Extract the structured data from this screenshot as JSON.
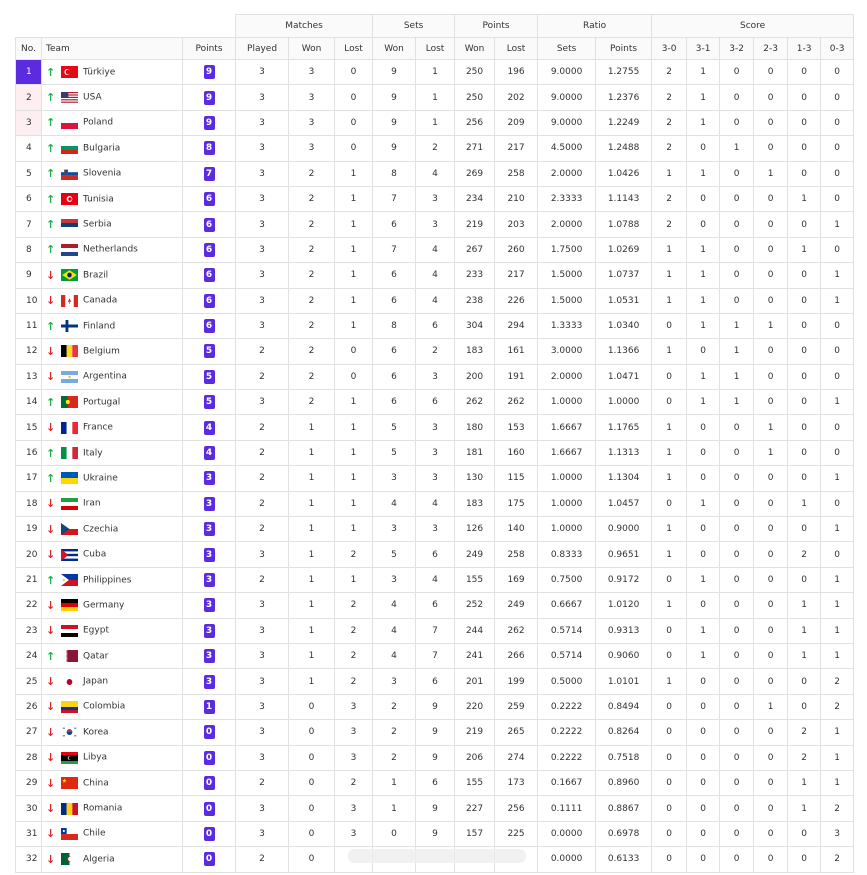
{
  "header": {
    "groups": {
      "matches": "Matches",
      "sets": "Sets",
      "points": "Points",
      "ratio": "Ratio",
      "score": "Score"
    },
    "cols": {
      "no": "No.",
      "team": "Team",
      "points": "Points",
      "played": "Played",
      "m_won": "Won",
      "m_lost": "Lost",
      "s_won": "Won",
      "s_lost": "Lost",
      "p_won": "Won",
      "p_lost": "Lost",
      "r_sets": "Sets",
      "r_points": "Points",
      "s30": "3-0",
      "s31": "3-1",
      "s32": "3-2",
      "s23": "2-3",
      "s13": "1-3",
      "s03": "0-3"
    }
  },
  "colors": {
    "accent": "#5b2be0",
    "up": "#1fae4b",
    "down": "#e0262b",
    "highlight": "#fdeff1"
  },
  "rows": [
    {
      "no": "1",
      "trend": "up",
      "team": "Türkiye",
      "flag": "tr",
      "pts": "9",
      "played": "3",
      "mw": "3",
      "ml": "0",
      "sw": "9",
      "sl": "1",
      "pw": "250",
      "pl": "196",
      "rs": "9.0000",
      "rp": "1.2755",
      "s30": "2",
      "s31": "1",
      "s32": "0",
      "s23": "0",
      "s13": "0",
      "s03": "0"
    },
    {
      "no": "2",
      "trend": "up",
      "team": "USA",
      "flag": "us",
      "pts": "9",
      "played": "3",
      "mw": "3",
      "ml": "0",
      "sw": "9",
      "sl": "1",
      "pw": "250",
      "pl": "202",
      "rs": "9.0000",
      "rp": "1.2376",
      "s30": "2",
      "s31": "1",
      "s32": "0",
      "s23": "0",
      "s13": "0",
      "s03": "0"
    },
    {
      "no": "3",
      "trend": "up",
      "team": "Poland",
      "flag": "pl",
      "pts": "9",
      "played": "3",
      "mw": "3",
      "ml": "0",
      "sw": "9",
      "sl": "1",
      "pw": "256",
      "pl": "209",
      "rs": "9.0000",
      "rp": "1.2249",
      "s30": "2",
      "s31": "1",
      "s32": "0",
      "s23": "0",
      "s13": "0",
      "s03": "0"
    },
    {
      "no": "4",
      "trend": "up",
      "team": "Bulgaria",
      "flag": "bg",
      "pts": "8",
      "played": "3",
      "mw": "3",
      "ml": "0",
      "sw": "9",
      "sl": "2",
      "pw": "271",
      "pl": "217",
      "rs": "4.5000",
      "rp": "1.2488",
      "s30": "2",
      "s31": "0",
      "s32": "1",
      "s23": "0",
      "s13": "0",
      "s03": "0"
    },
    {
      "no": "5",
      "trend": "up",
      "team": "Slovenia",
      "flag": "si",
      "pts": "7",
      "played": "3",
      "mw": "2",
      "ml": "1",
      "sw": "8",
      "sl": "4",
      "pw": "269",
      "pl": "258",
      "rs": "2.0000",
      "rp": "1.0426",
      "s30": "1",
      "s31": "1",
      "s32": "0",
      "s23": "1",
      "s13": "0",
      "s03": "0"
    },
    {
      "no": "6",
      "trend": "up",
      "team": "Tunisia",
      "flag": "tn",
      "pts": "6",
      "played": "3",
      "mw": "2",
      "ml": "1",
      "sw": "7",
      "sl": "3",
      "pw": "234",
      "pl": "210",
      "rs": "2.3333",
      "rp": "1.1143",
      "s30": "2",
      "s31": "0",
      "s32": "0",
      "s23": "0",
      "s13": "1",
      "s03": "0"
    },
    {
      "no": "7",
      "trend": "up",
      "team": "Serbia",
      "flag": "rs",
      "pts": "6",
      "played": "3",
      "mw": "2",
      "ml": "1",
      "sw": "6",
      "sl": "3",
      "pw": "219",
      "pl": "203",
      "rs": "2.0000",
      "rp": "1.0788",
      "s30": "2",
      "s31": "0",
      "s32": "0",
      "s23": "0",
      "s13": "0",
      "s03": "1"
    },
    {
      "no": "8",
      "trend": "up",
      "team": "Netherlands",
      "flag": "nl",
      "pts": "6",
      "played": "3",
      "mw": "2",
      "ml": "1",
      "sw": "7",
      "sl": "4",
      "pw": "267",
      "pl": "260",
      "rs": "1.7500",
      "rp": "1.0269",
      "s30": "1",
      "s31": "1",
      "s32": "0",
      "s23": "0",
      "s13": "1",
      "s03": "0"
    },
    {
      "no": "9",
      "trend": "down",
      "team": "Brazil",
      "flag": "br",
      "pts": "6",
      "played": "3",
      "mw": "2",
      "ml": "1",
      "sw": "6",
      "sl": "4",
      "pw": "233",
      "pl": "217",
      "rs": "1.5000",
      "rp": "1.0737",
      "s30": "1",
      "s31": "1",
      "s32": "0",
      "s23": "0",
      "s13": "0",
      "s03": "1"
    },
    {
      "no": "10",
      "trend": "down",
      "team": "Canada",
      "flag": "ca",
      "pts": "6",
      "played": "3",
      "mw": "2",
      "ml": "1",
      "sw": "6",
      "sl": "4",
      "pw": "238",
      "pl": "226",
      "rs": "1.5000",
      "rp": "1.0531",
      "s30": "1",
      "s31": "1",
      "s32": "0",
      "s23": "0",
      "s13": "0",
      "s03": "1"
    },
    {
      "no": "11",
      "trend": "up",
      "team": "Finland",
      "flag": "fi",
      "pts": "6",
      "played": "3",
      "mw": "2",
      "ml": "1",
      "sw": "8",
      "sl": "6",
      "pw": "304",
      "pl": "294",
      "rs": "1.3333",
      "rp": "1.0340",
      "s30": "0",
      "s31": "1",
      "s32": "1",
      "s23": "1",
      "s13": "0",
      "s03": "0"
    },
    {
      "no": "12",
      "trend": "down",
      "team": "Belgium",
      "flag": "be",
      "pts": "5",
      "played": "2",
      "mw": "2",
      "ml": "0",
      "sw": "6",
      "sl": "2",
      "pw": "183",
      "pl": "161",
      "rs": "3.0000",
      "rp": "1.1366",
      "s30": "1",
      "s31": "0",
      "s32": "1",
      "s23": "0",
      "s13": "0",
      "s03": "0"
    },
    {
      "no": "13",
      "trend": "down",
      "team": "Argentina",
      "flag": "ar",
      "pts": "5",
      "played": "2",
      "mw": "2",
      "ml": "0",
      "sw": "6",
      "sl": "3",
      "pw": "200",
      "pl": "191",
      "rs": "2.0000",
      "rp": "1.0471",
      "s30": "0",
      "s31": "1",
      "s32": "1",
      "s23": "0",
      "s13": "0",
      "s03": "0"
    },
    {
      "no": "14",
      "trend": "up",
      "team": "Portugal",
      "flag": "pt",
      "pts": "5",
      "played": "3",
      "mw": "2",
      "ml": "1",
      "sw": "6",
      "sl": "6",
      "pw": "262",
      "pl": "262",
      "rs": "1.0000",
      "rp": "1.0000",
      "s30": "0",
      "s31": "1",
      "s32": "1",
      "s23": "0",
      "s13": "0",
      "s03": "1"
    },
    {
      "no": "15",
      "trend": "down",
      "team": "France",
      "flag": "fr",
      "pts": "4",
      "played": "2",
      "mw": "1",
      "ml": "1",
      "sw": "5",
      "sl": "3",
      "pw": "180",
      "pl": "153",
      "rs": "1.6667",
      "rp": "1.1765",
      "s30": "1",
      "s31": "0",
      "s32": "0",
      "s23": "1",
      "s13": "0",
      "s03": "0"
    },
    {
      "no": "16",
      "trend": "up",
      "team": "Italy",
      "flag": "it",
      "pts": "4",
      "played": "2",
      "mw": "1",
      "ml": "1",
      "sw": "5",
      "sl": "3",
      "pw": "181",
      "pl": "160",
      "rs": "1.6667",
      "rp": "1.1313",
      "s30": "1",
      "s31": "0",
      "s32": "0",
      "s23": "1",
      "s13": "0",
      "s03": "0"
    },
    {
      "no": "17",
      "trend": "up",
      "team": "Ukraine",
      "flag": "ua",
      "pts": "3",
      "played": "2",
      "mw": "1",
      "ml": "1",
      "sw": "3",
      "sl": "3",
      "pw": "130",
      "pl": "115",
      "rs": "1.0000",
      "rp": "1.1304",
      "s30": "1",
      "s31": "0",
      "s32": "0",
      "s23": "0",
      "s13": "0",
      "s03": "1"
    },
    {
      "no": "18",
      "trend": "down",
      "team": "Iran",
      "flag": "ir",
      "pts": "3",
      "played": "2",
      "mw": "1",
      "ml": "1",
      "sw": "4",
      "sl": "4",
      "pw": "183",
      "pl": "175",
      "rs": "1.0000",
      "rp": "1.0457",
      "s30": "0",
      "s31": "1",
      "s32": "0",
      "s23": "0",
      "s13": "1",
      "s03": "0"
    },
    {
      "no": "19",
      "trend": "down",
      "team": "Czechia",
      "flag": "cz",
      "pts": "3",
      "played": "2",
      "mw": "1",
      "ml": "1",
      "sw": "3",
      "sl": "3",
      "pw": "126",
      "pl": "140",
      "rs": "1.0000",
      "rp": "0.9000",
      "s30": "1",
      "s31": "0",
      "s32": "0",
      "s23": "0",
      "s13": "0",
      "s03": "1"
    },
    {
      "no": "20",
      "trend": "down",
      "team": "Cuba",
      "flag": "cu",
      "pts": "3",
      "played": "3",
      "mw": "1",
      "ml": "2",
      "sw": "5",
      "sl": "6",
      "pw": "249",
      "pl": "258",
      "rs": "0.8333",
      "rp": "0.9651",
      "s30": "1",
      "s31": "0",
      "s32": "0",
      "s23": "0",
      "s13": "2",
      "s03": "0"
    },
    {
      "no": "21",
      "trend": "up",
      "team": "Philippines",
      "flag": "ph",
      "pts": "3",
      "played": "2",
      "mw": "1",
      "ml": "1",
      "sw": "3",
      "sl": "4",
      "pw": "155",
      "pl": "169",
      "rs": "0.7500",
      "rp": "0.9172",
      "s30": "0",
      "s31": "1",
      "s32": "0",
      "s23": "0",
      "s13": "0",
      "s03": "1"
    },
    {
      "no": "22",
      "trend": "down",
      "team": "Germany",
      "flag": "de",
      "pts": "3",
      "played": "3",
      "mw": "1",
      "ml": "2",
      "sw": "4",
      "sl": "6",
      "pw": "252",
      "pl": "249",
      "rs": "0.6667",
      "rp": "1.0120",
      "s30": "1",
      "s31": "0",
      "s32": "0",
      "s23": "0",
      "s13": "1",
      "s03": "1"
    },
    {
      "no": "23",
      "trend": "down",
      "team": "Egypt",
      "flag": "eg",
      "pts": "3",
      "played": "3",
      "mw": "1",
      "ml": "2",
      "sw": "4",
      "sl": "7",
      "pw": "244",
      "pl": "262",
      "rs": "0.5714",
      "rp": "0.9313",
      "s30": "0",
      "s31": "1",
      "s32": "0",
      "s23": "0",
      "s13": "1",
      "s03": "1"
    },
    {
      "no": "24",
      "trend": "up",
      "team": "Qatar",
      "flag": "qa",
      "pts": "3",
      "played": "3",
      "mw": "1",
      "ml": "2",
      "sw": "4",
      "sl": "7",
      "pw": "241",
      "pl": "266",
      "rs": "0.5714",
      "rp": "0.9060",
      "s30": "0",
      "s31": "1",
      "s32": "0",
      "s23": "0",
      "s13": "1",
      "s03": "1"
    },
    {
      "no": "25",
      "trend": "down",
      "team": "Japan",
      "flag": "jp",
      "pts": "3",
      "played": "3",
      "mw": "1",
      "ml": "2",
      "sw": "3",
      "sl": "6",
      "pw": "201",
      "pl": "199",
      "rs": "0.5000",
      "rp": "1.0101",
      "s30": "1",
      "s31": "0",
      "s32": "0",
      "s23": "0",
      "s13": "0",
      "s03": "2"
    },
    {
      "no": "26",
      "trend": "down",
      "team": "Colombia",
      "flag": "co",
      "pts": "1",
      "played": "3",
      "mw": "0",
      "ml": "3",
      "sw": "2",
      "sl": "9",
      "pw": "220",
      "pl": "259",
      "rs": "0.2222",
      "rp": "0.8494",
      "s30": "0",
      "s31": "0",
      "s32": "0",
      "s23": "1",
      "s13": "0",
      "s03": "2"
    },
    {
      "no": "27",
      "trend": "down",
      "team": "Korea",
      "flag": "kr",
      "pts": "0",
      "played": "3",
      "mw": "0",
      "ml": "3",
      "sw": "2",
      "sl": "9",
      "pw": "219",
      "pl": "265",
      "rs": "0.2222",
      "rp": "0.8264",
      "s30": "0",
      "s31": "0",
      "s32": "0",
      "s23": "0",
      "s13": "2",
      "s03": "1"
    },
    {
      "no": "28",
      "trend": "down",
      "team": "Libya",
      "flag": "ly",
      "pts": "0",
      "played": "3",
      "mw": "0",
      "ml": "3",
      "sw": "2",
      "sl": "9",
      "pw": "206",
      "pl": "274",
      "rs": "0.2222",
      "rp": "0.7518",
      "s30": "0",
      "s31": "0",
      "s32": "0",
      "s23": "0",
      "s13": "2",
      "s03": "1"
    },
    {
      "no": "29",
      "trend": "down",
      "team": "China",
      "flag": "cn",
      "pts": "0",
      "played": "2",
      "mw": "0",
      "ml": "2",
      "sw": "1",
      "sl": "6",
      "pw": "155",
      "pl": "173",
      "rs": "0.1667",
      "rp": "0.8960",
      "s30": "0",
      "s31": "0",
      "s32": "0",
      "s23": "0",
      "s13": "1",
      "s03": "1"
    },
    {
      "no": "30",
      "trend": "down",
      "team": "Romania",
      "flag": "ro",
      "pts": "0",
      "played": "3",
      "mw": "0",
      "ml": "3",
      "sw": "1",
      "sl": "9",
      "pw": "227",
      "pl": "256",
      "rs": "0.1111",
      "rp": "0.8867",
      "s30": "0",
      "s31": "0",
      "s32": "0",
      "s23": "0",
      "s13": "1",
      "s03": "2"
    },
    {
      "no": "31",
      "trend": "down",
      "team": "Chile",
      "flag": "cl",
      "pts": "0",
      "played": "3",
      "mw": "0",
      "ml": "3",
      "sw": "0",
      "sl": "9",
      "pw": "157",
      "pl": "225",
      "rs": "0.0000",
      "rp": "0.6978",
      "s30": "0",
      "s31": "0",
      "s32": "0",
      "s23": "0",
      "s13": "0",
      "s03": "3"
    },
    {
      "no": "32",
      "trend": "down",
      "team": "Algeria",
      "flag": "dz",
      "pts": "0",
      "played": "2",
      "mw": "0",
      "ml": "",
      "sw": "",
      "sl": "",
      "pw": "",
      "pl": "",
      "rs": "0.0000",
      "rp": "0.6133",
      "s30": "0",
      "s31": "0",
      "s32": "0",
      "s23": "0",
      "s13": "0",
      "s03": "2"
    }
  ]
}
